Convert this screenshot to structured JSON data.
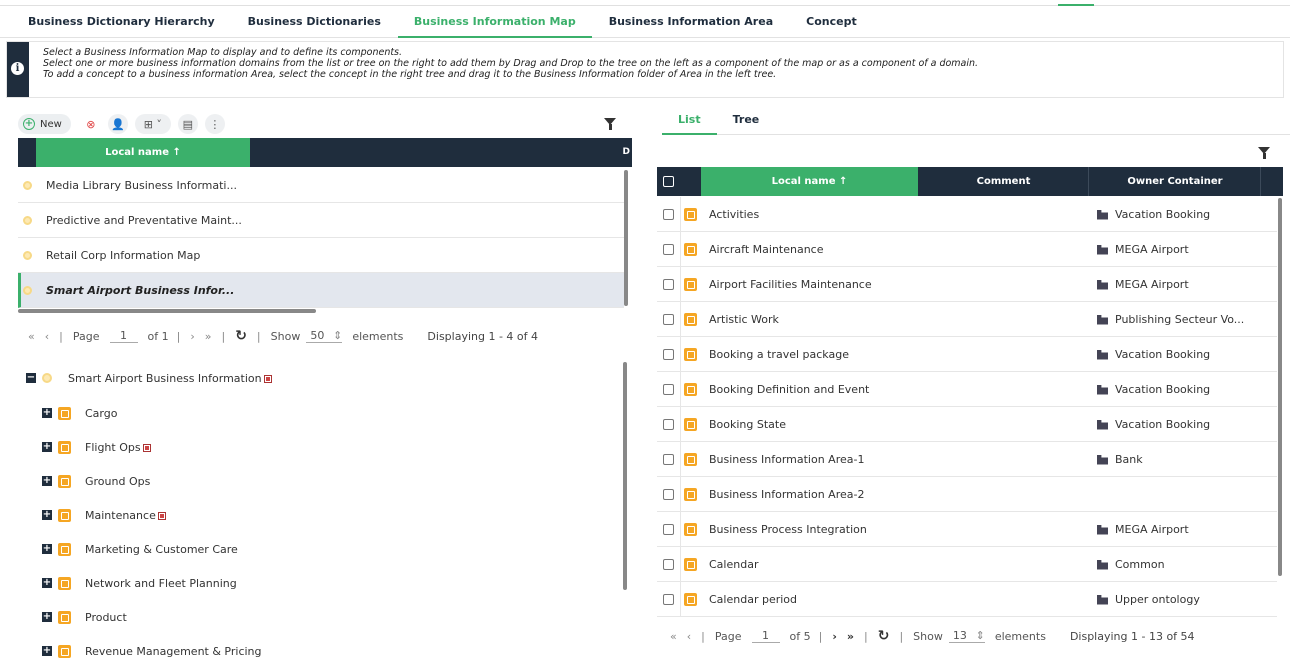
{
  "tabs": [
    "Business Dictionary Hierarchy",
    "Business Dictionaries",
    "Business Information Map",
    "Business Information Area",
    "Concept"
  ],
  "info": {
    "line1": "Select a Business Information Map to display and to define its components.",
    "line2": "Select one or more business information domains from the list or tree on the right to add them by Drag and Drop to the tree on the left as a component of the map or as a component of a domain.",
    "line3": "To add a concept to a business information Area, select the concept in the right tree and drag it to the Business Information folder of Area in the left tree."
  },
  "left": {
    "new_label": "New",
    "col_header": "Local name ↑",
    "col_d": "D",
    "rows": [
      "Media Library Business Informati...",
      "Predictive and Preventative Maint...",
      "Retail Corp Information Map",
      "Smart Airport Business Infor..."
    ],
    "pager": {
      "page_label": "Page",
      "page": "1",
      "of": "of 1",
      "show": "Show",
      "count": "50",
      "elements": "elements",
      "display": "Displaying 1 - 4 of 4"
    },
    "tree_root": "Smart Airport Business Information",
    "tree_items": [
      "Cargo",
      "Flight Ops",
      "Ground Ops",
      "Maintenance",
      "Marketing & Customer Care",
      "Network and Fleet Planning",
      "Product",
      "Revenue Management & Pricing"
    ]
  },
  "right": {
    "tabs": [
      "List",
      "Tree"
    ],
    "headers": {
      "name": "Local name ↑",
      "comment": "Comment",
      "owner": "Owner Container"
    },
    "rows": [
      {
        "name": "Activities",
        "owner": "Vacation Booking"
      },
      {
        "name": "Aircraft Maintenance",
        "owner": "MEGA Airport"
      },
      {
        "name": "Airport Facilities Maintenance",
        "owner": "MEGA Airport"
      },
      {
        "name": "Artistic Work",
        "owner": "Publishing Secteur Vo..."
      },
      {
        "name": "Booking a travel package",
        "owner": "Vacation Booking"
      },
      {
        "name": "Booking Definition and Event",
        "owner": "Vacation Booking"
      },
      {
        "name": "Booking State",
        "owner": "Vacation Booking"
      },
      {
        "name": "Business Information Area-1",
        "owner": "Bank"
      },
      {
        "name": "Business Information Area-2",
        "owner": ""
      },
      {
        "name": "Business Process Integration",
        "owner": "MEGA Airport"
      },
      {
        "name": "Calendar",
        "owner": "Common"
      },
      {
        "name": "Calendar period",
        "owner": "Upper ontology"
      }
    ],
    "pager": {
      "page_label": "Page",
      "page": "1",
      "of": "of 5",
      "show": "Show",
      "count": "13",
      "elements": "elements",
      "display": "Displaying 1 - 13 of 54"
    }
  },
  "colors": {
    "accent": "#3bb06b",
    "header": "#1f2d3d",
    "area_icon": "#f5a623"
  }
}
